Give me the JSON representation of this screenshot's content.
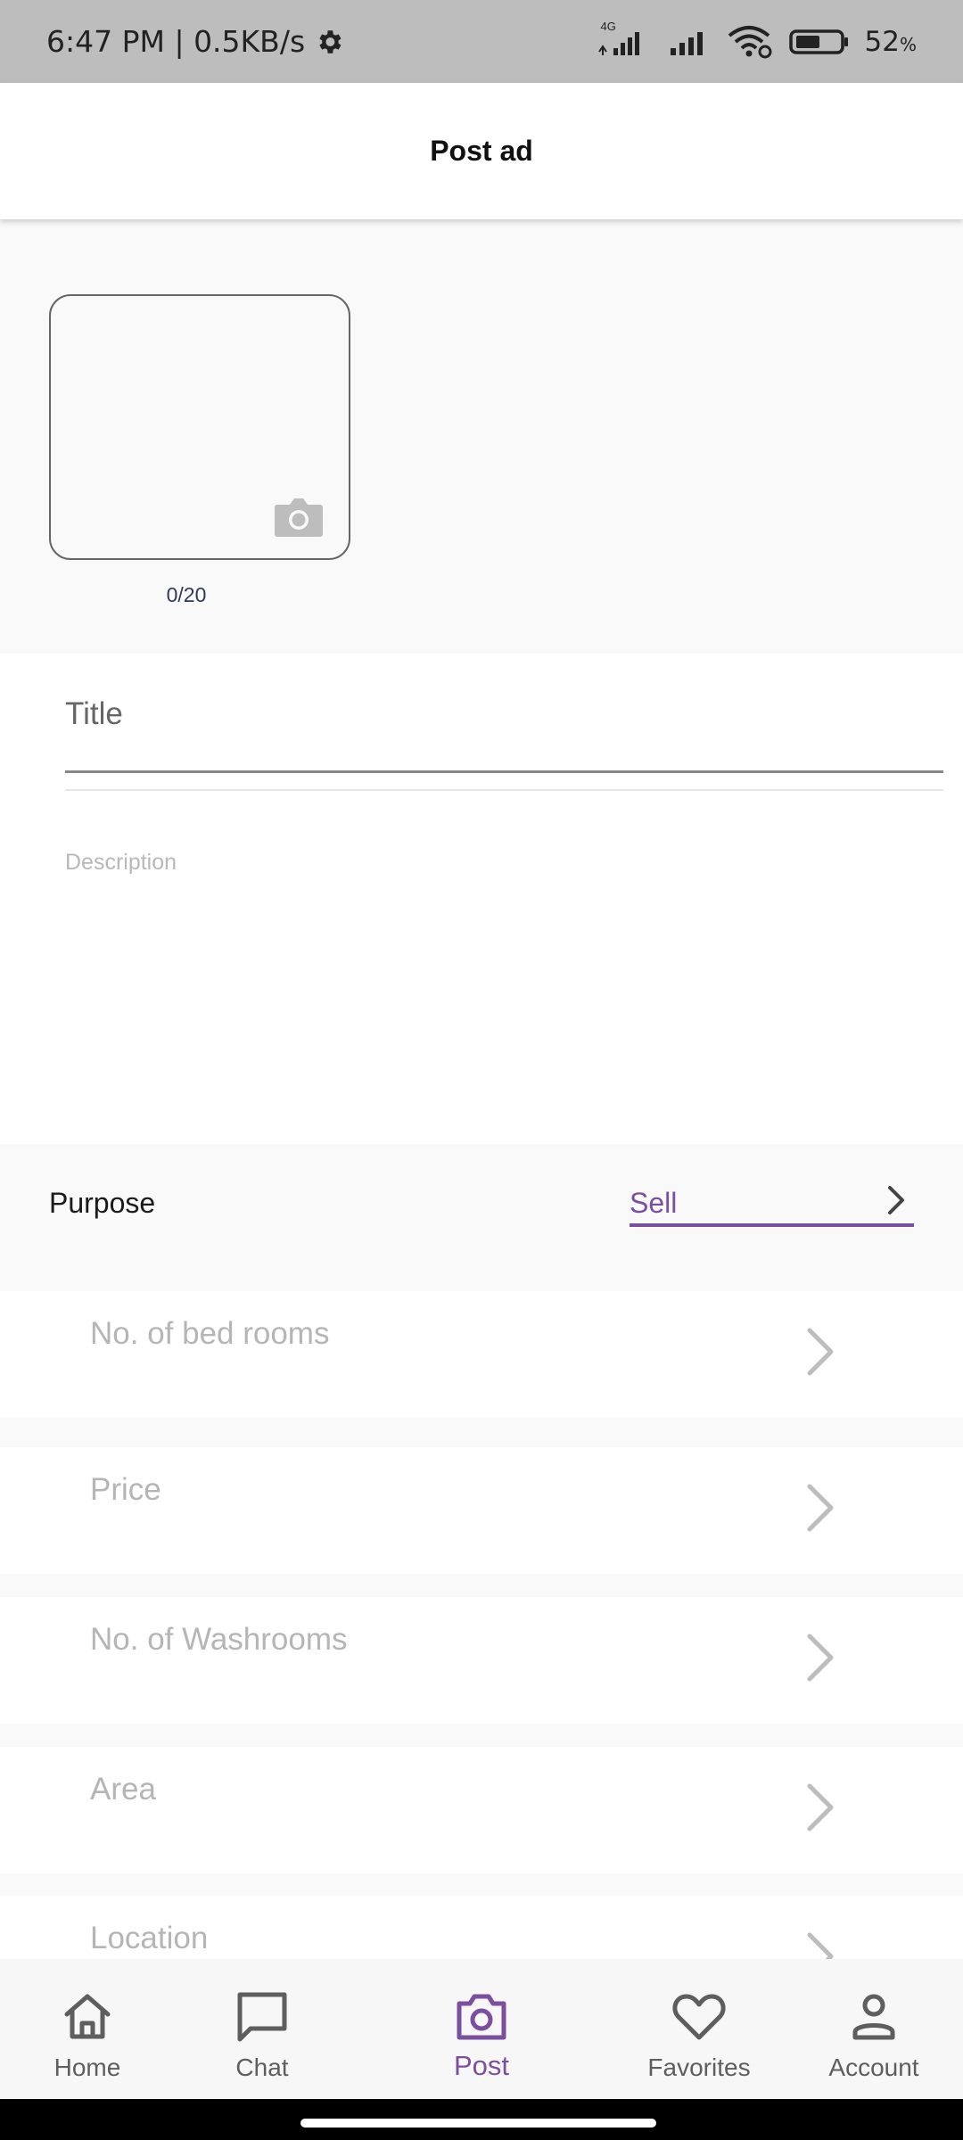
{
  "status_bar": {
    "time_speed": "6:47 PM | 0.5KB/s",
    "network_type": "4G",
    "battery_percent": "52",
    "battery_suffix": "%",
    "icons": [
      "gear-icon",
      "signal-icon",
      "wifi-icon",
      "battery-icon"
    ]
  },
  "app_bar": {
    "title": "Post ad"
  },
  "photos": {
    "count_text": "0/20",
    "icon": "camera-icon"
  },
  "form": {
    "title_label": "Title",
    "description_label": "Description"
  },
  "purpose": {
    "label": "Purpose",
    "value": "Sell",
    "accent_color": "#7b4fa0"
  },
  "fields": [
    {
      "label": "No. of bed rooms"
    },
    {
      "label": "Price"
    },
    {
      "label": "No. of Washrooms"
    },
    {
      "label": "Area"
    },
    {
      "label": "Location"
    }
  ],
  "bottom_nav": {
    "items": [
      {
        "label": "Home",
        "icon": "home-icon"
      },
      {
        "label": "Chat",
        "icon": "chat-icon"
      },
      {
        "label": "Post",
        "icon": "camera-icon",
        "active": true
      },
      {
        "label": "Favorites",
        "icon": "heart-icon"
      },
      {
        "label": "Account",
        "icon": "person-icon"
      }
    ]
  }
}
